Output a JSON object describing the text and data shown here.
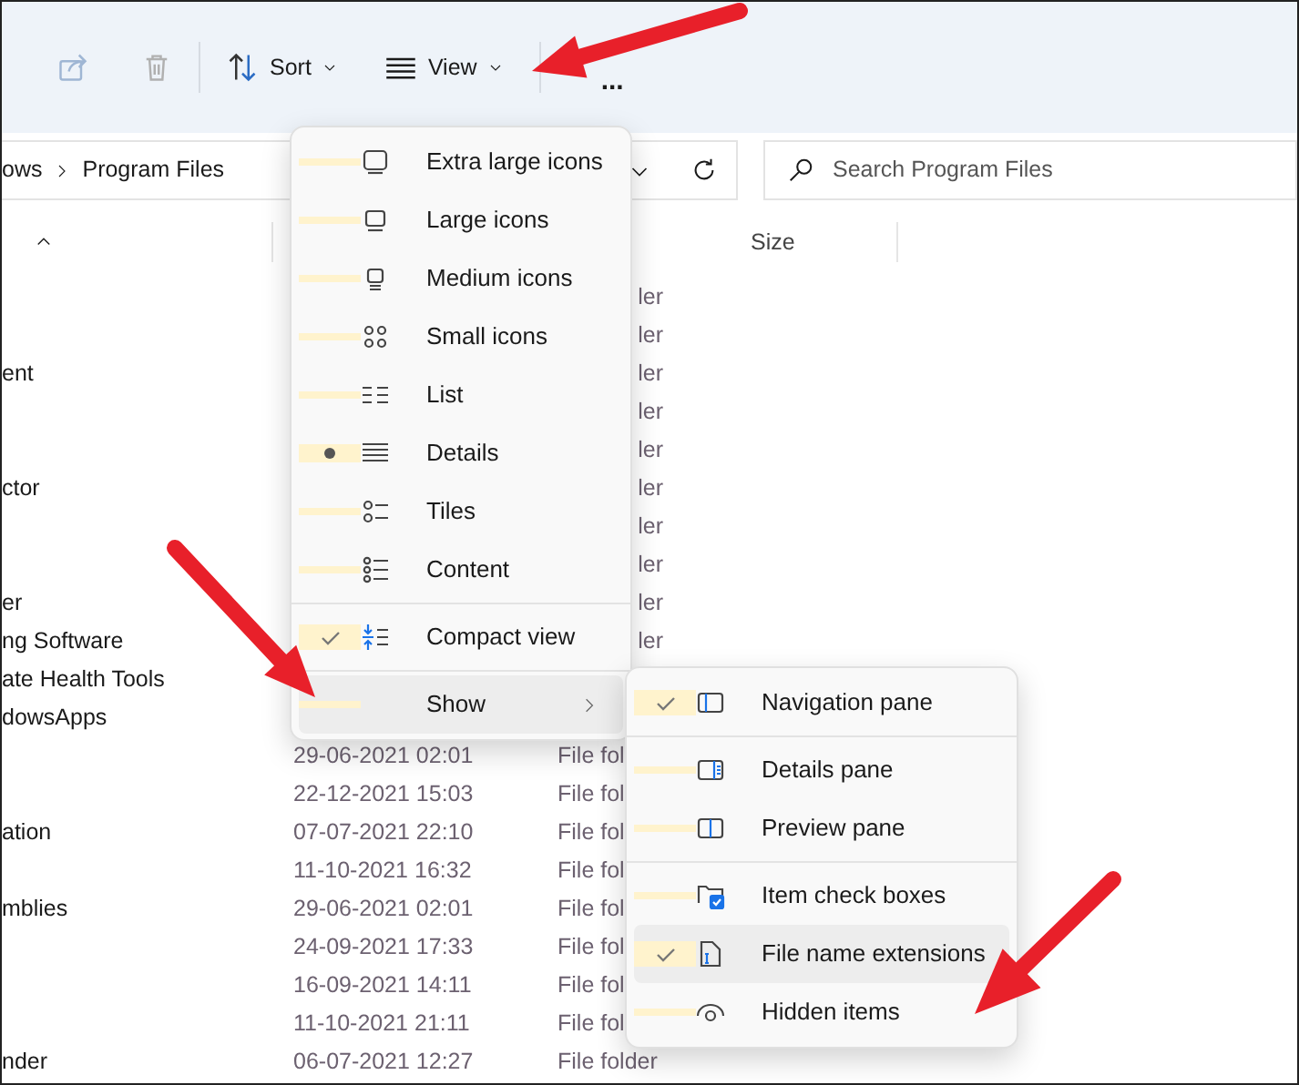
{
  "toolbar": {
    "items": [
      {
        "kind": "share",
        "disabled": true
      },
      {
        "kind": "delete",
        "disabled": true
      },
      {
        "kind": "sort",
        "label": "Sort"
      },
      {
        "kind": "view",
        "label": "View"
      },
      {
        "kind": "more",
        "label": "..."
      }
    ]
  },
  "address_bar": {
    "path": [
      "ows",
      "Program Files"
    ]
  },
  "search": {
    "placeholder": "Search Program Files"
  },
  "columns": [
    {
      "label": "Size"
    }
  ],
  "rows": [
    {
      "type": "ler",
      "clipped_left": true
    },
    {
      "type": "ler",
      "clipped_left": true
    },
    {
      "name": "ent",
      "type": "ler",
      "clipped_left": true
    },
    {
      "type": "ler",
      "clipped_left": true
    },
    {
      "type": "ler",
      "clipped_left": true
    },
    {
      "name": "ctor",
      "type": "ler",
      "clipped_left": true
    },
    {
      "type": "ler",
      "clipped_left": true
    },
    {
      "type": "ler",
      "clipped_left": true
    },
    {
      "name": "er",
      "type": "ler",
      "clipped_left": true
    },
    {
      "name": "ng Software",
      "type": "ler",
      "clipped_left": true
    },
    {
      "name": "ate Health Tools"
    },
    {
      "name": "dowsApps"
    },
    {
      "date": "29-06-2021 02:01",
      "type": "File fol",
      "clipped_left": false
    },
    {
      "date": "22-12-2021 15:03",
      "type": "File fol",
      "clipped_left": false
    },
    {
      "name": "ation",
      "date": "07-07-2021 22:10",
      "type": "File fol",
      "clipped_left": false
    },
    {
      "date": "11-10-2021 16:32",
      "type": "File fol",
      "clipped_left": false
    },
    {
      "name": "mblies",
      "date": "29-06-2021 02:01",
      "type": "File fol",
      "clipped_left": false
    },
    {
      "date": "24-09-2021 17:33",
      "type": "File fol",
      "clipped_left": false
    },
    {
      "date": "16-09-2021 14:11",
      "type": "File fol",
      "clipped_left": false
    },
    {
      "date": "11-10-2021 21:11",
      "type": "File fol",
      "clipped_left": false
    },
    {
      "name": "nder",
      "date": "06-07-2021 12:27",
      "type": "File folder",
      "clipped_left": false
    }
  ],
  "view_menu": {
    "items": [
      {
        "kind": "layout",
        "label": "Extra large icons",
        "selected": false
      },
      {
        "kind": "layout",
        "label": "Large icons",
        "selected": false
      },
      {
        "kind": "layout",
        "label": "Medium icons",
        "selected": false
      },
      {
        "kind": "layout",
        "label": "Small icons",
        "selected": false
      },
      {
        "kind": "layout",
        "label": "List",
        "selected": false
      },
      {
        "kind": "layout",
        "label": "Details",
        "selected": true
      },
      {
        "kind": "layout",
        "label": "Tiles",
        "selected": false
      },
      {
        "kind": "layout",
        "label": "Content",
        "selected": false
      },
      {
        "kind": "divider"
      },
      {
        "kind": "toggle",
        "label": "Compact view",
        "checked": true
      },
      {
        "kind": "divider"
      },
      {
        "kind": "submenu",
        "label": "Show",
        "expanded": true
      }
    ]
  },
  "show_menu": {
    "items": [
      {
        "kind": "toggle",
        "label": "Navigation pane",
        "checked": true,
        "hovered": false
      },
      {
        "kind": "divider"
      },
      {
        "kind": "toggle",
        "label": "Details pane",
        "checked": false,
        "hovered": false
      },
      {
        "kind": "toggle",
        "label": "Preview pane",
        "checked": false,
        "hovered": false
      },
      {
        "kind": "divider"
      },
      {
        "kind": "toggle",
        "label": "Item check boxes",
        "checked": false,
        "hovered": false
      },
      {
        "kind": "toggle",
        "label": "File name extensions",
        "checked": true,
        "hovered": true
      },
      {
        "kind": "toggle",
        "label": "Hidden items",
        "checked": false,
        "hovered": false
      }
    ]
  },
  "annotations": [
    {
      "kind": "arrow"
    },
    {
      "kind": "arrow"
    },
    {
      "kind": "arrow"
    }
  ]
}
